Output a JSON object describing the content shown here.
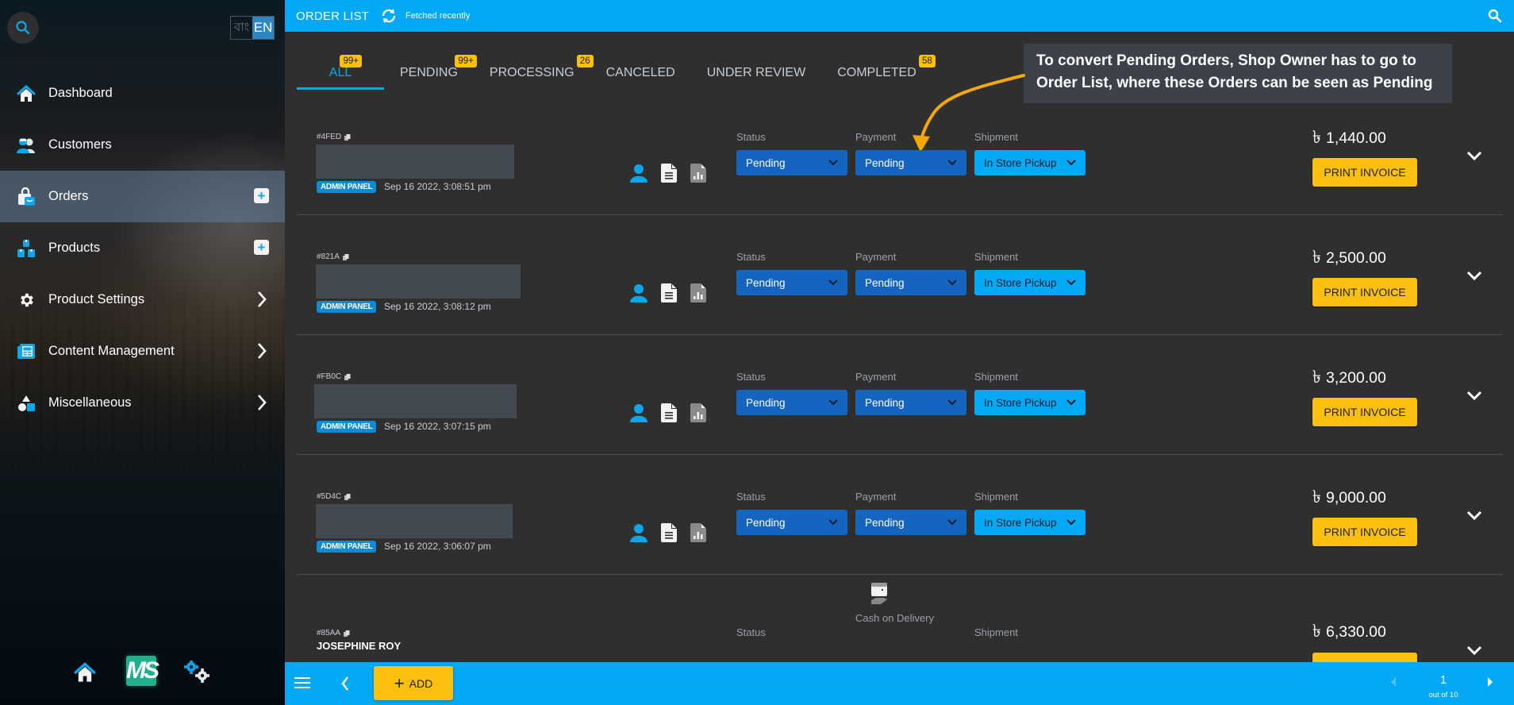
{
  "sidebar": {
    "lang_bn": "বাং",
    "lang_en": "EN",
    "items": [
      {
        "label": "Dashboard",
        "icon": "home-icon"
      },
      {
        "label": "Customers",
        "icon": "customers-icon"
      },
      {
        "label": "Orders",
        "icon": "orders-bag-icon",
        "active": true,
        "has_add": true
      },
      {
        "label": "Products",
        "icon": "products-boxes-icon",
        "has_add": true
      },
      {
        "label": "Product Settings",
        "icon": "gear-icon",
        "has_submenu": true
      },
      {
        "label": "Content Management",
        "icon": "newspaper-icon",
        "has_submenu": true
      },
      {
        "label": "Miscellaneous",
        "icon": "shapes-icon",
        "has_submenu": true
      }
    ],
    "add_symbol": "+",
    "logo_text": "MS"
  },
  "topbar": {
    "title": "ORDER LIST",
    "fetch_status": "Fetched recently"
  },
  "tabs": [
    {
      "label": "ALL",
      "badge": "99+",
      "active": true
    },
    {
      "label": "PENDING",
      "badge": "99+"
    },
    {
      "label": "PROCESSING",
      "badge": "26"
    },
    {
      "label": "CANCELED",
      "badge": null
    },
    {
      "label": "UNDER REVIEW",
      "badge": null
    },
    {
      "label": "COMPLETED",
      "badge": "58"
    }
  ],
  "callout": {
    "text": "To convert Pending Orders, Shop Owner has to go to Order List, where these Orders can be seen as Pending"
  },
  "labels": {
    "status": "Status",
    "payment": "Payment",
    "shipment": "Shipment",
    "print_invoice": "PRINT INVOICE",
    "currency": "৳"
  },
  "orders": [
    {
      "id": "#4FED",
      "source": "ADMIN PANEL",
      "date": "Sep 16 2022, 3:08:51 pm",
      "status": "Pending",
      "payment": "Pending",
      "shipment": "In Store Pickup",
      "amount": "1,440.00"
    },
    {
      "id": "#821A",
      "source": "ADMIN PANEL",
      "date": "Sep 16 2022, 3:08:12 pm",
      "status": "Pending",
      "payment": "Pending",
      "shipment": "In Store Pickup",
      "amount": "2,500.00"
    },
    {
      "id": "#FB0C",
      "source": "ADMIN PANEL",
      "date": "Sep 16 2022, 3:07:15 pm",
      "status": "Pending",
      "payment": "Pending",
      "shipment": "In Store Pickup",
      "amount": "3,200.00"
    },
    {
      "id": "#5D4C",
      "source": "ADMIN PANEL",
      "date": "Sep 16 2022, 3:06:07 pm",
      "status": "Pending",
      "payment": "Pending",
      "shipment": "In Store Pickup",
      "amount": "9,000.00"
    },
    {
      "id": "#85AA",
      "customer": "JOSEPHINE ROY",
      "payment_method": "Cash on Delivery",
      "amount": "6,330.00"
    }
  ],
  "bottombar": {
    "add_label": "ADD",
    "page": "1",
    "page_total": "out of 10"
  },
  "colors": {
    "accent": "#03a9f4",
    "status_select": "#1565c0",
    "button_yellow": "#fbbf0f",
    "badge_blue": "#0f8bd6",
    "callout_bg": "#3d424a",
    "arrow": "#f5a800"
  }
}
